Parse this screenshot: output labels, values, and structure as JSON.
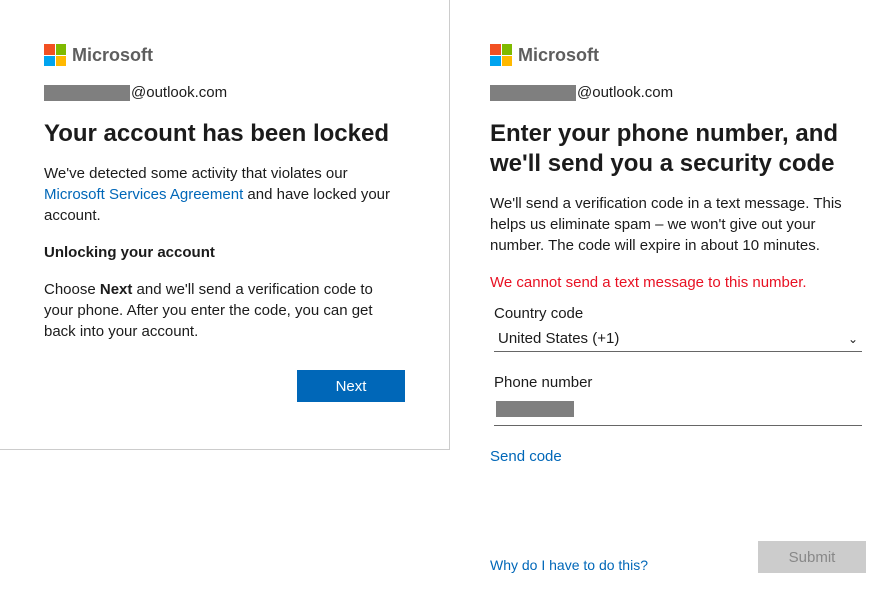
{
  "brand": "Microsoft",
  "left": {
    "email_suffix": "@outlook.com",
    "title": "Your account has been locked",
    "body_pre": "We've detected some activity that violates our ",
    "agreement_link": "Microsoft Services Agreement",
    "body_post": " and have locked your account.",
    "subheading": "Unlocking your account",
    "instruction_pre": "Choose ",
    "instruction_bold": "Next",
    "instruction_post": " and we'll send a verification code to your phone. After you enter the code, you can get back into your account.",
    "next_label": "Next"
  },
  "right": {
    "email_suffix": "@outlook.com",
    "title": "Enter your phone number, and we'll send you a security code",
    "body": "We'll send a verification code in a text message. This helps us eliminate spam – we won't give out your number. The code will expire in about 10 minutes.",
    "error": "We cannot send a text message to this number.",
    "country_label": "Country code",
    "country_value": "United States (+1)",
    "phone_label": "Phone number",
    "send_code": "Send code",
    "why_link": "Why do I have to do this?",
    "submit_label": "Submit"
  }
}
